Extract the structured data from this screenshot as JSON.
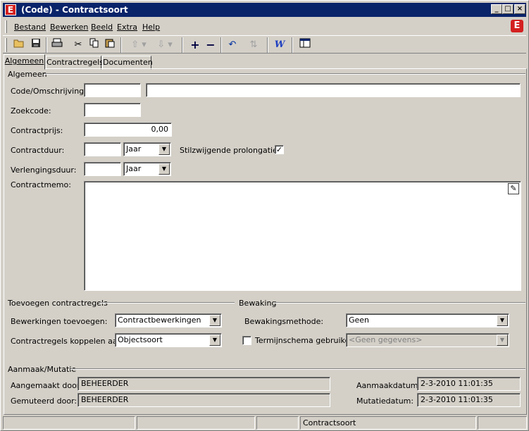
{
  "window": {
    "title": "(Code) - Contractsoort",
    "app_icon": "E"
  },
  "menu": {
    "items": [
      {
        "label": "Bestand"
      },
      {
        "label": "Bewerken"
      },
      {
        "label": "Beeld"
      },
      {
        "label": "Extra"
      },
      {
        "label": "Help"
      }
    ],
    "logo": "E"
  },
  "toolbar": {
    "icons": [
      "open-folder-icon",
      "save-icon",
      "print-icon",
      "cut-icon",
      "copy-icon",
      "paste-icon",
      "arrow-up-icon",
      "arrow-down-icon",
      "add-icon",
      "remove-icon",
      "undo-icon",
      "refresh-icon",
      "word-icon",
      "layout-icon"
    ]
  },
  "tabs": [
    {
      "label": "Algemeen"
    },
    {
      "label": "Contractregels"
    },
    {
      "label": "Documenten"
    }
  ],
  "algemeen": {
    "group_title": "Algemeen",
    "code_label": "Code/Omschrijving:",
    "code_value": "",
    "omschrijving_value": "",
    "zoekcode_label": "Zoekcode:",
    "zoekcode_value": "",
    "contractprijs_label": "Contractprijs:",
    "contractprijs_value": "0,00",
    "contractduur_label": "Contractduur:",
    "contractduur_value": "",
    "contractduur_unit": "Jaar",
    "prolongatie_label": "Stilzwijgende prolongatie?",
    "prolongatie_checked": true,
    "verlengingsduur_label": "Verlengingsduur:",
    "verlengingsduur_value": "",
    "verlengingsduur_unit": "Jaar",
    "memo_label": "Contractmemo:",
    "memo_value": ""
  },
  "toevoegen": {
    "group_title": "Toevoegen contractregels",
    "bewerkingen_label": "Bewerkingen toevoegen:",
    "bewerkingen_value": "Contractbewerkingen",
    "koppelen_label": "Contractregels koppelen aan:",
    "koppelen_value": "Objectsoort"
  },
  "bewaking": {
    "group_title": "Bewaking",
    "methode_label": "Bewakingsmethode:",
    "methode_value": "Geen",
    "termijn_label": "Termijnschema gebruiken",
    "termijn_checked": false,
    "termijn_value": "<Geen gegevens>"
  },
  "mutatie": {
    "group_title": "Aanmaak/Mutatie",
    "aangemaakt_label": "Aangemaakt door:",
    "aangemaakt_value": "BEHEERDER",
    "gemuteerd_label": "Gemuteerd door:",
    "gemuteerd_value": "BEHEERDER",
    "aanmaakdatum_label": "Aanmaakdatum:",
    "aanmaakdatum_value": "2-3-2010 11:01:35",
    "mutatiedatum_label": "Mutatiedatum:",
    "mutatiedatum_value": "2-3-2010 11:01:35"
  },
  "status": {
    "cells": [
      "",
      "",
      "",
      "Contractsoort",
      ""
    ]
  }
}
